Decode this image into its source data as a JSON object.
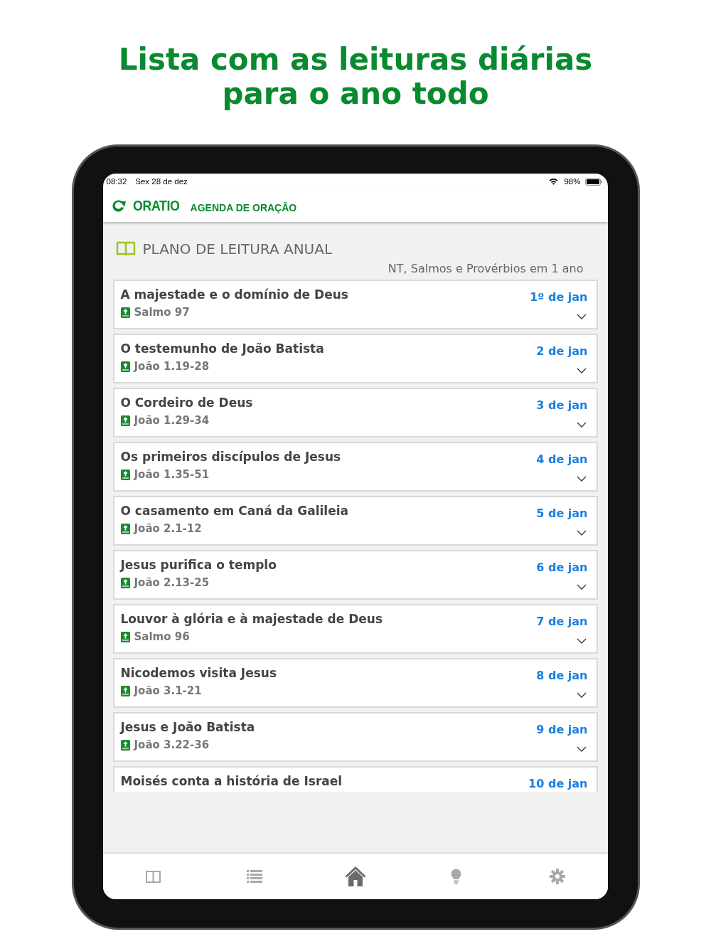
{
  "headline": [
    "Lista com as leituras diárias",
    "para o ano todo"
  ],
  "status_bar": {
    "time": "08:32",
    "date": "Sex 28 de dez",
    "battery": "98%"
  },
  "app_bar": {
    "brand": "ORATIO",
    "subtitle": "AGENDA DE ORAÇÃO"
  },
  "section": {
    "title": "PLANO DE LEITURA ANUAL",
    "subtitle": "NT, Salmos e Provérbios em 1 ano"
  },
  "readings": [
    {
      "title": "A majestade e o domínio de Deus",
      "ref": "Salmo 97",
      "date": "1º de jan"
    },
    {
      "title": "O testemunho de João Batista",
      "ref": "João 1.19-28",
      "date": "2 de jan"
    },
    {
      "title": "O Cordeiro de Deus",
      "ref": "João 1.29-34",
      "date": "3 de jan"
    },
    {
      "title": "Os primeiros discípulos de Jesus",
      "ref": "João 1.35-51",
      "date": "4 de jan"
    },
    {
      "title": "O casamento em Caná da Galileia",
      "ref": "João 2.1-12",
      "date": "5 de jan"
    },
    {
      "title": "Jesus purifica o templo",
      "ref": "João 2.13-25",
      "date": "6 de jan"
    },
    {
      "title": "Louvor à glória e à majestade de Deus",
      "ref": "Salmo 96",
      "date": "7 de jan"
    },
    {
      "title": "Nicodemos visita Jesus",
      "ref": "João 3.1-21",
      "date": "8 de jan"
    },
    {
      "title": "Jesus e João Batista",
      "ref": "João 3.22-36",
      "date": "9 de jan"
    },
    {
      "title": "Moisés conta a história de Israel",
      "date": "10 de jan"
    }
  ],
  "tab_bar": [
    {
      "kind": "book",
      "selected": false
    },
    {
      "kind": "list",
      "selected": false
    },
    {
      "kind": "home",
      "selected": true
    },
    {
      "kind": "bulb",
      "selected": false
    },
    {
      "kind": "gear",
      "selected": false
    }
  ]
}
